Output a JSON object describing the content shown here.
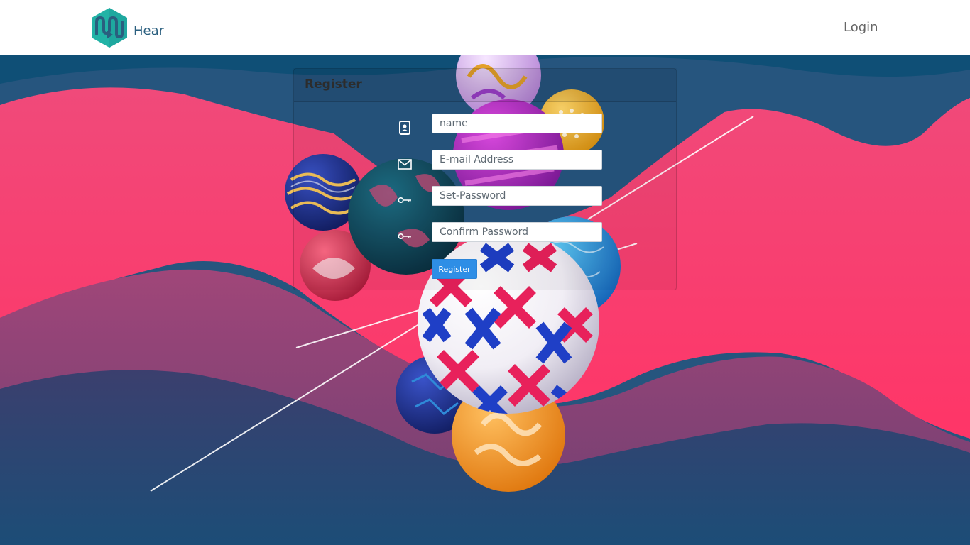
{
  "brand": {
    "name": "Hear",
    "logo_icon": "hexagon-waveform-play-logo",
    "logo_colors": [
      "#1fb7a8",
      "#2a5f7f"
    ]
  },
  "nav": {
    "login_label": "Login"
  },
  "register": {
    "title": "Register",
    "fields": [
      {
        "name": "name",
        "icon": "id-badge-icon",
        "placeholder": "name"
      },
      {
        "name": "email",
        "icon": "envelope-icon",
        "placeholder": "E-mail Address"
      },
      {
        "name": "password",
        "icon": "key-icon",
        "placeholder": "Set-Password"
      },
      {
        "name": "confirm_password",
        "icon": "key-icon",
        "placeholder": "Confirm Password"
      }
    ],
    "button_label": "Register",
    "button_color": "#2e8ee6"
  },
  "colors": {
    "background_deep": "#0f4f76",
    "wave_pink": "#ff3b6e",
    "wave_mauve": "#8a4a78"
  }
}
